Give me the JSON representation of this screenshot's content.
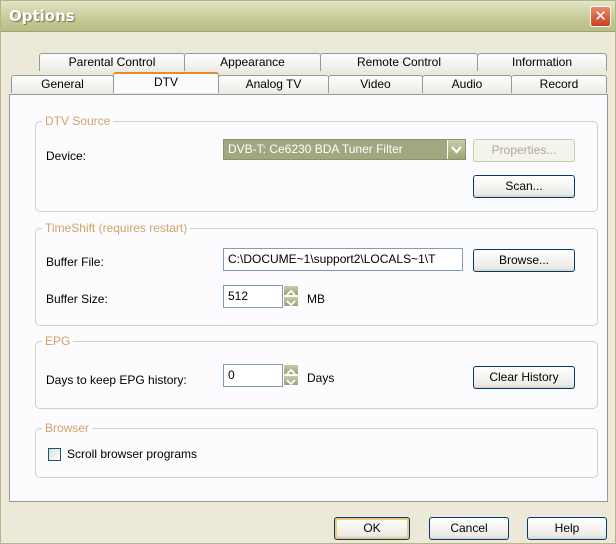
{
  "window": {
    "title": "Options"
  },
  "tabs_row1": [
    {
      "label": "Parental Control"
    },
    {
      "label": "Appearance"
    },
    {
      "label": "Remote Control"
    },
    {
      "label": "Information"
    }
  ],
  "tabs_row2": [
    {
      "label": "General"
    },
    {
      "label": "DTV",
      "active": true
    },
    {
      "label": "Analog TV"
    },
    {
      "label": "Video"
    },
    {
      "label": "Audio"
    },
    {
      "label": "Record"
    }
  ],
  "dtv_source": {
    "legend": "DTV Source",
    "device_label": "Device:",
    "device_value": "DVB-T: Ce6230 BDA Tuner Filter",
    "properties_label": "Properties...",
    "scan_label": "Scan..."
  },
  "timeshift": {
    "legend": "TimeShift (requires restart)",
    "buffer_file_label": "Buffer File:",
    "buffer_file_value": "C:\\DOCUME~1\\support2\\LOCALS~1\\T",
    "browse_label": "Browse...",
    "buffer_size_label": "Buffer Size:",
    "buffer_size_value": "512",
    "buffer_size_unit": "MB"
  },
  "epg": {
    "legend": "EPG",
    "days_label": "Days to keep EPG history:",
    "days_value": "0",
    "days_unit": "Days",
    "clear_label": "Clear History"
  },
  "browser": {
    "legend": "Browser",
    "scroll_label": "Scroll browser programs",
    "scroll_checked": false
  },
  "footer": {
    "ok_label": "OK",
    "cancel_label": "Cancel",
    "help_label": "Help"
  },
  "colors": {
    "active_tab_accent": "#e68b2c",
    "legend_text": "#d0a26b",
    "combo_bg": "#a1a781"
  }
}
